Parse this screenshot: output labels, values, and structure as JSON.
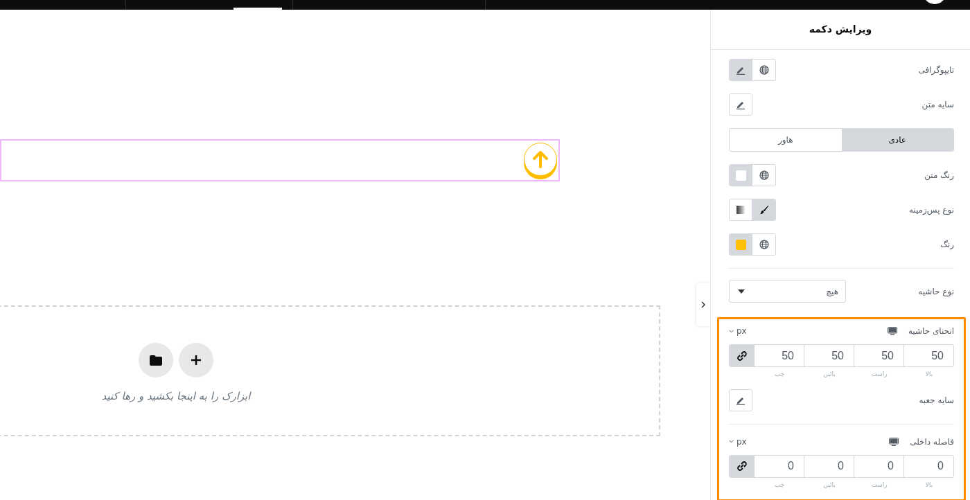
{
  "canvas": {
    "section": {
      "selected": true
    },
    "drop_zone": {
      "hint": "ابزارک را به اینجا بکشید و رها کنید"
    }
  },
  "panel": {
    "title": "ویرایش دکمه",
    "sections": [
      {
        "highlighted": false,
        "controls": [
          {
            "kind": "typography",
            "label": "تایپوگرافی"
          },
          {
            "kind": "edit",
            "label": "سایه متن"
          },
          {
            "kind": "tabs",
            "tabs": [
              {
                "label": "عادی",
                "selected": true
              },
              {
                "label": "هاور",
                "selected": false
              }
            ]
          },
          {
            "kind": "color",
            "label": "رنگ متن",
            "color": "#ffffff"
          },
          {
            "kind": "choice",
            "label": "نوع پس‌زمینه",
            "options": [
              {
                "kind": "classic",
                "selected": true
              },
              {
                "kind": "gradient",
                "selected": false
              }
            ]
          },
          {
            "kind": "color",
            "label": "رنگ",
            "color": "#ffc107"
          },
          {
            "kind": "divider"
          },
          {
            "kind": "select",
            "label": "نوع حاشیه",
            "value": "هیچ"
          }
        ]
      },
      {
        "highlighted": true,
        "controls": [
          {
            "kind": "dimensions",
            "label": "انحنای حاشیه",
            "unit": "px",
            "linked": true,
            "fields": [
              {
                "value": "50",
                "label": "بالا"
              },
              {
                "value": "50",
                "label": "راست"
              },
              {
                "value": "50",
                "label": "پائین"
              },
              {
                "value": "50",
                "label": "چپ"
              }
            ]
          },
          {
            "kind": "edit",
            "label": "سایه جعبه"
          },
          {
            "kind": "divider"
          },
          {
            "kind": "dimensions",
            "label": "فاصله داخلی",
            "unit": "px",
            "linked": true,
            "fields": [
              {
                "value": "0",
                "label": "بالا"
              },
              {
                "value": "0",
                "label": "راست"
              },
              {
                "value": "0",
                "label": "پائین"
              },
              {
                "value": "0",
                "label": "چپ"
              }
            ]
          }
        ]
      }
    ]
  }
}
